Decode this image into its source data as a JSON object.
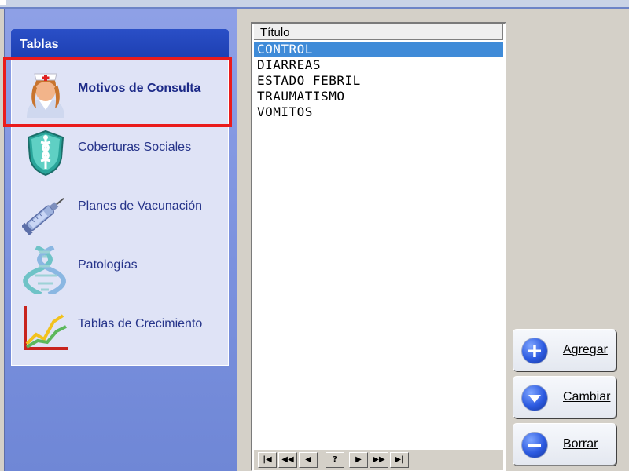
{
  "panel": {
    "title": "Tablas",
    "items": [
      {
        "label": "Motivos de Consulta",
        "icon": "nurse-icon",
        "selected": true
      },
      {
        "label": "Coberturas Sociales",
        "icon": "shield-caduceus-icon",
        "selected": false
      },
      {
        "label": "Planes de Vacunación",
        "icon": "syringe-icon",
        "selected": false
      },
      {
        "label": "Patologías",
        "icon": "dna-icon",
        "selected": false
      },
      {
        "label": "Tablas de Crecimiento",
        "icon": "growth-chart-icon",
        "selected": false
      }
    ]
  },
  "list": {
    "column_header": "Título",
    "rows": [
      "CONTROL",
      "DIARREAS",
      "ESTADO FEBRIL",
      "TRAUMATISMO",
      "VOMITOS"
    ],
    "selected_row": "CONTROL",
    "navigator": [
      "first",
      "prev-page",
      "prev",
      "?",
      "next",
      "next-page",
      "last"
    ],
    "navigator_help": "?"
  },
  "actions": {
    "add": "Agregar",
    "change": "Cambiar",
    "delete": "Borrar"
  },
  "colors": {
    "highlight": "#3f8bd8",
    "panel_header": "#2a4fc7",
    "callout": "#ea1b1b"
  }
}
